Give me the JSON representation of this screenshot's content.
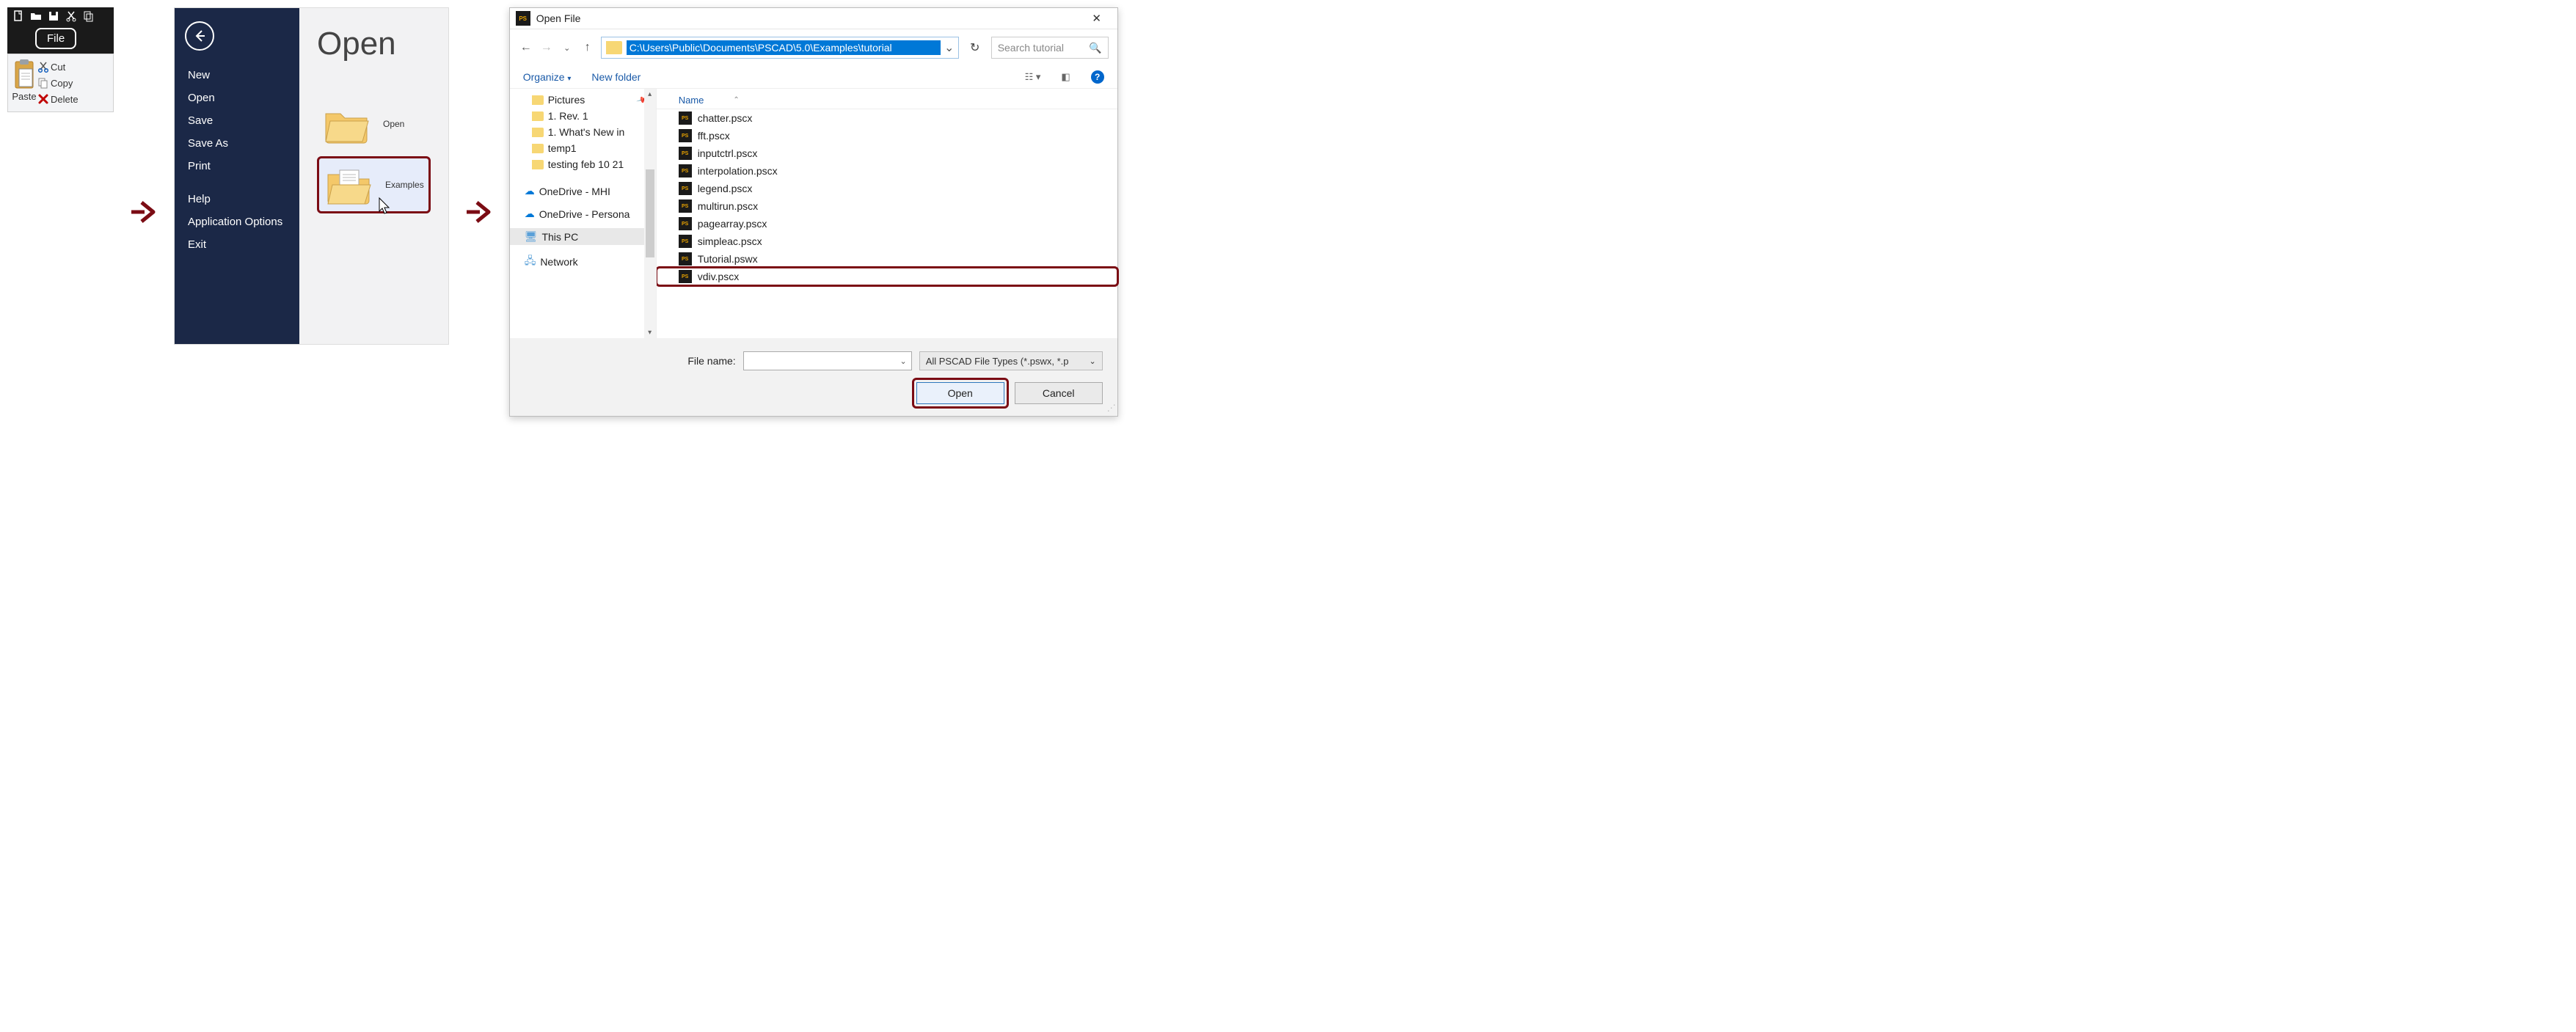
{
  "panel1": {
    "file_tab": "File",
    "paste": "Paste",
    "cut": "Cut",
    "copy": "Copy",
    "delete": "Delete"
  },
  "panel2": {
    "title": "Open",
    "menu": [
      "New",
      "Open",
      "Save",
      "Save As",
      "Print"
    ],
    "menu2": [
      "Help",
      "Application Options",
      "Exit"
    ],
    "item_open": "Open",
    "item_examples": "Examples"
  },
  "panel3": {
    "title": "Open File",
    "path": "C:\\Users\\Public\\Documents\\PSCAD\\5.0\\Examples\\tutorial",
    "search_placeholder": "Search tutorial",
    "organize": "Organize",
    "new_folder": "New folder",
    "tree": [
      {
        "label": "Pictures",
        "type": "folder",
        "pinned": true
      },
      {
        "label": "1. Rev. 1",
        "type": "folder"
      },
      {
        "label": "1. What's New in",
        "type": "folder"
      },
      {
        "label": "temp1",
        "type": "folder"
      },
      {
        "label": "testing feb 10 21",
        "type": "folder"
      },
      {
        "label": "OneDrive - MHI",
        "type": "cloud"
      },
      {
        "label": "OneDrive - Persona",
        "type": "cloud"
      },
      {
        "label": "This PC",
        "type": "pc",
        "selected": true
      },
      {
        "label": "Network",
        "type": "net"
      }
    ],
    "name_col": "Name",
    "files": [
      "chatter.pscx",
      "fft.pscx",
      "inputctrl.pscx",
      "interpolation.pscx",
      "legend.pscx",
      "multirun.pscx",
      "pagearray.pscx",
      "simpleac.pscx",
      "Tutorial.pswx",
      "vdiv.pscx"
    ],
    "highlight_file": "vdiv.pscx",
    "fn_label": "File name:",
    "filter": "All PSCAD File Types (*.pswx, *.p",
    "open_btn": "Open",
    "cancel_btn": "Cancel"
  }
}
